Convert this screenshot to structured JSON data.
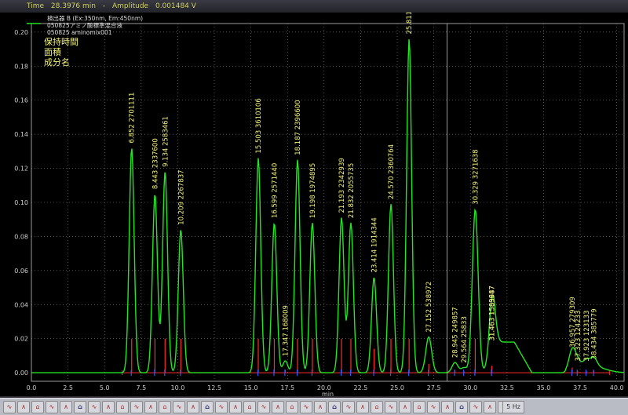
{
  "status": {
    "time_label": "Time",
    "time_value": "28.3976 min",
    "sep": "-",
    "amp_label": "Amplitude",
    "amp_value": "0.001484 V"
  },
  "legend": {
    "lines": [
      "検出器 B (Ex:350nm, Em:450nm)",
      "050825アミノ酸標準混合液",
      "050825 aminomix001"
    ],
    "annotation_lines": [
      "保持時間",
      "面積",
      "成分名"
    ]
  },
  "toolbar": {
    "buttons": [
      "zoom-in",
      "zoom-out",
      "undo",
      "redo",
      "print",
      "copy",
      "paste",
      "peak-add",
      "peak-del",
      "split",
      "merge",
      "baseline-1",
      "baseline-2",
      "baseline-3",
      "baseline-4",
      "baseline-5",
      "baseline-6",
      "baseline-7",
      "baseline-8",
      "baseline-9",
      "baseline-10",
      "baseline-11",
      "baseline-12",
      "baseline-13",
      "baseline-14",
      "valley-1",
      "valley-2",
      "valley-3",
      "skim-1",
      "skim-2",
      "tangent",
      "fill",
      "integrate-1",
      "integrate-2",
      "sum",
      "fit",
      "scale"
    ],
    "zoom_label": "5 Hz"
  },
  "chart_data": {
    "type": "line",
    "title": "",
    "xlabel": "min",
    "ylabel": "",
    "xlim": [
      0.0,
      40.5
    ],
    "ylim": [
      -0.005,
      0.205
    ],
    "xticks": [
      0.0,
      2.5,
      5.0,
      7.5,
      10.0,
      12.5,
      15.0,
      17.5,
      20.0,
      22.5,
      25.0,
      27.5,
      30.0,
      32.5,
      35.0,
      37.5,
      40.0
    ],
    "xtick_labels": [
      "0.0",
      "2.5",
      "5.0",
      "7.5",
      "10.0",
      "12.5",
      "15.0",
      "17.5",
      "20.0",
      "22.5",
      "25.0",
      "27.5",
      "30.0",
      "32.5",
      "35.0",
      "37.5",
      "40.0"
    ],
    "yticks": [
      0.0,
      0.02,
      0.04,
      0.06,
      0.08,
      0.1,
      0.12,
      0.14,
      0.16,
      0.18,
      0.2
    ],
    "ytick_labels": [
      "0.00",
      "0.02",
      "0.04",
      "0.06",
      "0.08",
      "0.10",
      "0.12",
      "0.14",
      "0.16",
      "0.18",
      "0.20"
    ],
    "cursor_x": 28.4,
    "grid": true,
    "colors": {
      "trace": "#21e621",
      "baseline": "#ff2a2a",
      "markers": "#3b55ff",
      "labels": "#f2f27a",
      "grid": "#8a8a8a"
    },
    "series": [
      {
        "style": "peaks",
        "peaks": [
          {
            "rt": 6.852,
            "area": "2701111",
            "rt_label": "6.852",
            "height": 0.132
          },
          {
            "rt": 8.443,
            "area": "2337600",
            "rt_label": "8.443",
            "height": 0.105
          },
          {
            "rt": 9.134,
            "area": "2583461",
            "rt_label": "9.134",
            "height": 0.118
          },
          {
            "rt": 10.209,
            "area": "2267837",
            "rt_label": "10.209",
            "height": 0.084
          },
          {
            "rt": 15.503,
            "area": "3610106",
            "rt_label": "15.503",
            "height": 0.126
          },
          {
            "rt": 16.599,
            "area": "2571440",
            "rt_label": "16.599",
            "height": 0.088
          },
          {
            "rt": 17.347,
            "area": "168009",
            "rt_label": "17.347",
            "height": 0.007
          },
          {
            "rt": 18.187,
            "area": "2396600",
            "rt_label": "18.187",
            "height": 0.125
          },
          {
            "rt": 19.198,
            "area": "1974895",
            "rt_label": "19.198",
            "height": 0.088
          },
          {
            "rt": 21.193,
            "area": "2342939",
            "rt_label": "21.193",
            "height": 0.091
          },
          {
            "rt": 21.832,
            "area": "2055735",
            "rt_label": "21.832",
            "height": 0.088
          },
          {
            "rt": 23.414,
            "area": "1914344",
            "rt_label": "23.414",
            "height": 0.056
          },
          {
            "rt": 24.57,
            "area": "2360764",
            "rt_label": "24.570",
            "height": 0.099
          },
          {
            "rt": 25.811,
            "area": "3227220",
            "rt_label": "25.811",
            "height": 0.196
          },
          {
            "rt": 27.152,
            "area": "538972",
            "rt_label": "27.152",
            "height": 0.021
          },
          {
            "rt": 28.945,
            "area": "249857",
            "rt_label": "28.945",
            "height": 0.006
          },
          {
            "rt": 29.564,
            "area": "25833",
            "rt_label": "29.564",
            "height": 0.003
          },
          {
            "rt": 30.329,
            "area": "3271638",
            "rt_label": "30.329",
            "height": 0.096
          },
          {
            "rt": 31.463,
            "area": "1583647",
            "rt_label": "31.463",
            "height": 0.016
          },
          {
            "rt": 31.463,
            "area": "1589987",
            "rt_label": "31.463",
            "height": 0.016
          },
          {
            "rt": 36.957,
            "area": "279309",
            "rt_label": "36.957",
            "height": 0.012
          },
          {
            "rt": 37.323,
            "area": "124233",
            "rt_label": "37.323",
            "height": 0.004
          },
          {
            "rt": 37.923,
            "area": "123133",
            "rt_label": "37.923",
            "height": 0.004
          },
          {
            "rt": 38.434,
            "area": "385779",
            "rt_label": "38.434",
            "height": 0.005
          }
        ]
      }
    ]
  }
}
